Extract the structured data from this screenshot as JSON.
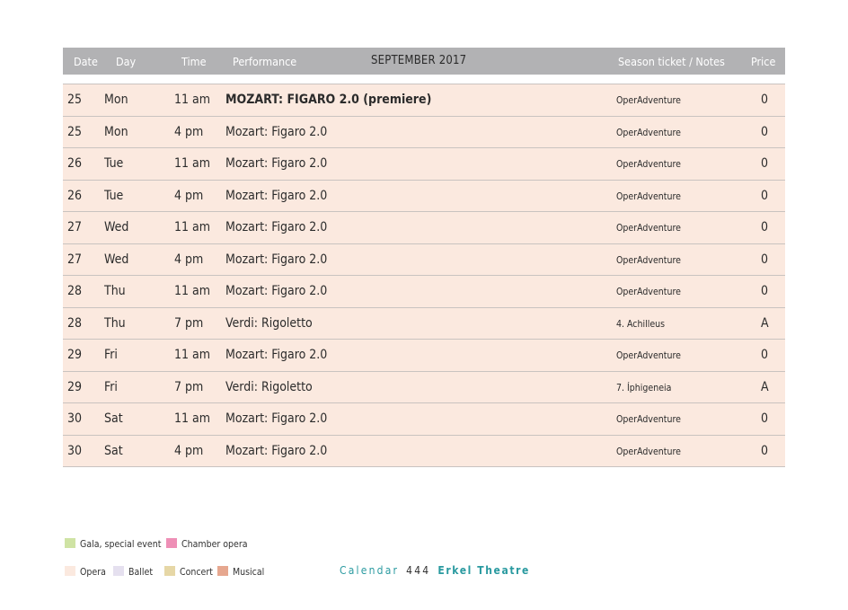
{
  "header": {
    "date": "Date",
    "day": "Day",
    "time": "Time",
    "performance": "Performance",
    "title": "SEPTEMBER 2017",
    "notes": "Season ticket / Notes",
    "price": "Price"
  },
  "rows": [
    {
      "date": "25",
      "day": "Mon",
      "time": "11 am",
      "performance": "MOZART: FIGARO 2.0 (premiere)",
      "notes": "OperAdventure",
      "price": "0",
      "bold": true
    },
    {
      "date": "25",
      "day": "Mon",
      "time": "4 pm",
      "performance": "Mozart: Figaro 2.0",
      "notes": "OperAdventure",
      "price": "0"
    },
    {
      "date": "26",
      "day": "Tue",
      "time": "11 am",
      "performance": "Mozart: Figaro 2.0",
      "notes": "OperAdventure",
      "price": "0"
    },
    {
      "date": "26",
      "day": "Tue",
      "time": "4 pm",
      "performance": "Mozart: Figaro 2.0",
      "notes": "OperAdventure",
      "price": "0"
    },
    {
      "date": "27",
      "day": "Wed",
      "time": "11 am",
      "performance": "Mozart: Figaro 2.0",
      "notes": "OperAdventure",
      "price": "0"
    },
    {
      "date": "27",
      "day": "Wed",
      "time": "4 pm",
      "performance": "Mozart: Figaro 2.0",
      "notes": "OperAdventure",
      "price": "0"
    },
    {
      "date": "28",
      "day": "Thu",
      "time": "11 am",
      "performance": "Mozart: Figaro 2.0",
      "notes": "OperAdventure",
      "price": "0"
    },
    {
      "date": "28",
      "day": "Thu",
      "time": "7 pm",
      "performance": "Verdi: Rigoletto",
      "notes": "4. Achilleus",
      "price": "A"
    },
    {
      "date": "29",
      "day": "Fri",
      "time": "11 am",
      "performance": "Mozart: Figaro 2.0",
      "notes": "OperAdventure",
      "price": "0"
    },
    {
      "date": "29",
      "day": "Fri",
      "time": "7 pm",
      "performance": "Verdi: Rigoletto",
      "notes": "7. Íphigeneia",
      "price": "A"
    },
    {
      "date": "30",
      "day": "Sat",
      "time": "11 am",
      "performance": "Mozart: Figaro 2.0",
      "notes": "OperAdventure",
      "price": "0"
    },
    {
      "date": "30",
      "day": "Sat",
      "time": "4 pm",
      "performance": "Mozart: Figaro 2.0",
      "notes": "OperAdventure",
      "price": "0"
    }
  ],
  "legend": {
    "row1": [
      {
        "label": "Gala, special event",
        "color": "#cfe3a4"
      },
      {
        "label": "Chamber opera",
        "color": "#ee8fb6"
      }
    ],
    "row2": [
      {
        "label": "Opera",
        "color": "#fbe9df"
      },
      {
        "label": "Ballet",
        "color": "#e5e0ef"
      },
      {
        "label": "Concert",
        "color": "#e6d7a6"
      },
      {
        "label": "Musical",
        "color": "#e6a78f"
      }
    ]
  },
  "footer": {
    "section": "Calendar",
    "page": "444",
    "theatre": "Erkel Theatre"
  }
}
